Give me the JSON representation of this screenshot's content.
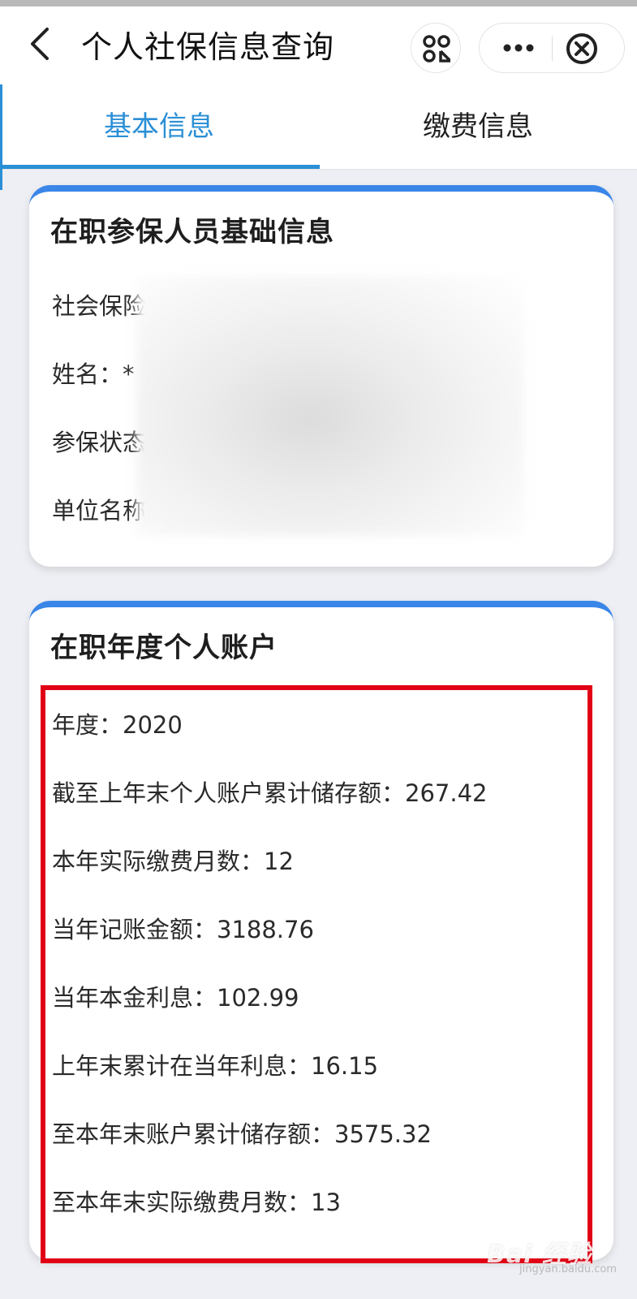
{
  "navbar": {
    "title": "个人社保信息查询",
    "icons": {
      "back": "back-chevron-icon",
      "scan": "mini-program-scan-icon",
      "more": "more-dots-icon",
      "close": "close-circle-icon"
    }
  },
  "tabs": [
    {
      "label": "基本信息",
      "active": true
    },
    {
      "label": "缴费信息",
      "active": false
    }
  ],
  "basic_info_card": {
    "title": "在职参保人员基础信息",
    "fields": [
      "社会保险",
      "姓名：*",
      "参保状态",
      "单位名称"
    ]
  },
  "account_card": {
    "title": "在职年度个人账户",
    "rows": [
      "年度：2020",
      "截至上年末个人账户累计储存额：267.42",
      "本年实际缴费月数：12",
      "当年记账金额：3188.76",
      "当年本金利息：102.99",
      "上年末累计在当年利息：16.15",
      "至本年末账户累计储存额：3575.32",
      "至本年末实际缴费月数：13"
    ]
  },
  "watermark": {
    "text": "Bai 经验",
    "sub": "jingyan.baidu.com"
  },
  "colors": {
    "accent": "#2b8fd6",
    "card_top": "#3a86e8",
    "highlight": "#e10016",
    "background": "#eeeff4"
  }
}
